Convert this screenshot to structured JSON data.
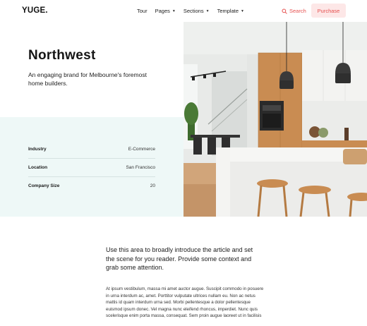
{
  "brand": {
    "logo": "YUGE."
  },
  "nav": {
    "items": [
      {
        "label": "Tour",
        "has_caret": false
      },
      {
        "label": "Pages",
        "has_caret": true
      },
      {
        "label": "Sections",
        "has_caret": true
      },
      {
        "label": "Template",
        "has_caret": true
      }
    ],
    "search_label": "Search",
    "purchase_label": "Purchase"
  },
  "hero": {
    "title": "Northwest",
    "subtitle": "An engaging brand for Melbourne's foremost home builders.",
    "image_icon": "kitchen-photo"
  },
  "details": [
    {
      "label": "Industry",
      "value": "E-Commerce"
    },
    {
      "label": "Location",
      "value": "San Francisco"
    },
    {
      "label": "Company Size",
      "value": "20"
    }
  ],
  "article": {
    "lead": "Use this area to broadly introduce the article and set the scene for you reader. Provide some context and grab some attention.",
    "body": "At ipsum vestibulum, massa mi amet auctor augue. Suscipit commodo in posuere in urna interdum ac, amet. Porttitor vulputate ultrices nullam eu. Non ac netus mattis id quam interdum urna sed. Morbi pellentesque a dolor pellentesque euismod ipsum donec. Vel magna nunc eleifend rhoncus, imperdiet. Nunc quis scelerisque enim porta massa, consequat. Sem proin augue laoreet ut in facilisis"
  },
  "colors": {
    "accent": "#e6504f",
    "accent_bg": "#fde7e7",
    "mint": "#eef8f7"
  }
}
